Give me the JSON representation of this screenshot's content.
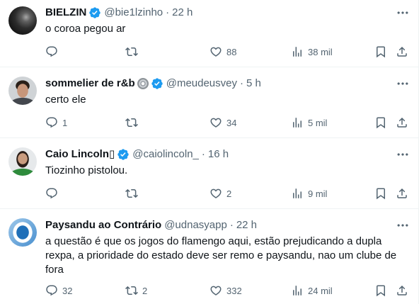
{
  "separator": "·",
  "colors": {
    "text": "#0f1419",
    "secondary": "#536471",
    "verified": "#1d9bf0",
    "divider": "#eff3f4",
    "background": "#ffffff"
  },
  "icons": {
    "reply": "reply-icon",
    "repost": "repost-icon",
    "like": "heart-icon",
    "views": "views-icon",
    "bookmark": "bookmark-icon",
    "share": "share-icon",
    "more": "more-icon",
    "verified": "verified-badge-icon"
  },
  "tweets": [
    {
      "name": "BIELZIN",
      "verified": true,
      "handle": "@bie1lzinho",
      "time": "22 h",
      "text": "o coroa pegou ar",
      "likes": "88",
      "views": "38 mil"
    },
    {
      "name": "sommelier de r&b",
      "name_emoji": "disc-emoji-icon",
      "verified": true,
      "handle": "@meudeusvey",
      "time": "5 h",
      "text": "certo ele",
      "replies": "1",
      "likes": "34",
      "views": "5 mil"
    },
    {
      "name": "Caio Lincoln▯",
      "verified": true,
      "handle": "@caiolincoln_",
      "time": "16 h",
      "text": "Tiozinho pistolou.",
      "likes": "2",
      "views": "9 mil"
    },
    {
      "name": "Paysandu ao Contrário",
      "verified": false,
      "handle": "@udnasyapp",
      "time": "22 h",
      "text": "a questão é que os jogos do flamengo aqui, estão prejudicando a dupla rexpa, a prioridade do estado deve ser remo e paysandu, nao um clube de fora",
      "replies": "32",
      "reposts": "2",
      "likes": "332",
      "views": "24 mil"
    }
  ]
}
